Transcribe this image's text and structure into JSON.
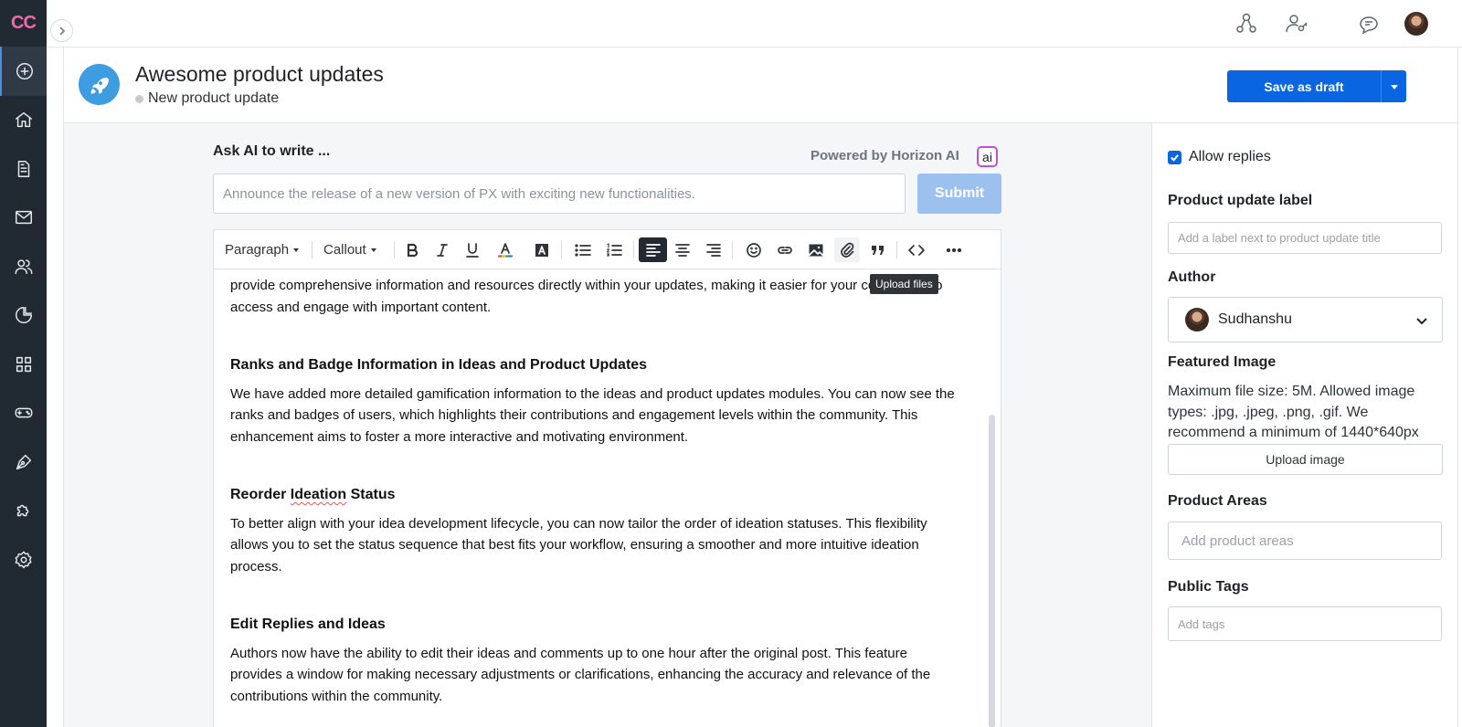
{
  "app": {
    "logo_text": "CC"
  },
  "sidebar": {
    "items": [
      {
        "name": "create",
        "icon": "plus-circle-icon",
        "active": true
      },
      {
        "name": "home",
        "icon": "home-icon"
      },
      {
        "name": "documents",
        "icon": "document-icon"
      },
      {
        "name": "mail",
        "icon": "mail-icon"
      },
      {
        "name": "users",
        "icon": "users-icon"
      },
      {
        "name": "analytics",
        "icon": "pie-chart-icon"
      },
      {
        "name": "apps",
        "icon": "grid-icon"
      },
      {
        "name": "games",
        "icon": "gamepad-icon"
      },
      {
        "name": "design",
        "icon": "pen-tool-icon"
      },
      {
        "name": "integrations",
        "icon": "puzzle-icon"
      },
      {
        "name": "settings",
        "icon": "gear-icon"
      }
    ]
  },
  "topbar": {
    "icons": [
      "network-icon",
      "user-key-icon",
      "chat-icon",
      "user-avatar"
    ]
  },
  "header": {
    "title": "Awesome product updates",
    "subtitle": "New product update",
    "save_label": "Save as draft"
  },
  "ai": {
    "label": "Ask AI to write ...",
    "powered_by": "Powered by Horizon AI",
    "badge": "ai",
    "placeholder": "Announce the release of a new version of PX with exciting new functionalities.",
    "submit_label": "Submit"
  },
  "toolbar": {
    "paragraph_label": "Paragraph",
    "callout_label": "Callout",
    "tooltip": "Upload files"
  },
  "editor": {
    "intro_text": "provide comprehensive information and resources directly within your updates, making it easier for your community to access and engage with important content.",
    "sections": [
      {
        "heading": "Ranks and Badge Information in Ideas and Product Updates",
        "body": "We have added more detailed gamification information to the ideas and product updates modules. You can now see the ranks and badges of users, which highlights their contributions and engagement levels within the community. This enhancement aims to foster a more interactive and motivating environment."
      },
      {
        "heading_pre": "Reorder ",
        "heading_flagged": "Ideation",
        "heading_post": " Status",
        "body": "To better align with your idea development lifecycle, you can now tailor the order of ideation statuses. This flexibility allows you to set the status sequence that best fits your workflow, ensuring a smoother and more intuitive ideation process."
      },
      {
        "heading": "Edit Replies and Ideas",
        "body": "Authors now have the ability to edit their ideas and comments up to one hour after the original post. This feature provides a window for making necessary adjustments or clarifications, enhancing the accuracy and relevance of the contributions within the community."
      }
    ]
  },
  "right_panel": {
    "allow_replies_label": "Allow replies",
    "allow_replies_checked": true,
    "label_title": "Product update label",
    "label_placeholder": "Add a label next to product update title",
    "author_title": "Author",
    "author_name": "Sudhanshu",
    "featured_title": "Featured Image",
    "featured_help": "Maximum file size: 5M. Allowed image types: .jpg, .jpeg, .png, .gif. We recommend a minimum of 1440*640px",
    "upload_label": "Upload image",
    "areas_title": "Product Areas",
    "areas_placeholder": "Add product areas",
    "tags_title": "Public Tags",
    "tags_placeholder": "Add tags"
  },
  "colors": {
    "sidebar_bg": "#212a33",
    "primary": "#0a66e0",
    "submit_disabled": "#9dc1ee",
    "logo": "#f06aa8",
    "header_icon_bg": "#3d9de0"
  }
}
